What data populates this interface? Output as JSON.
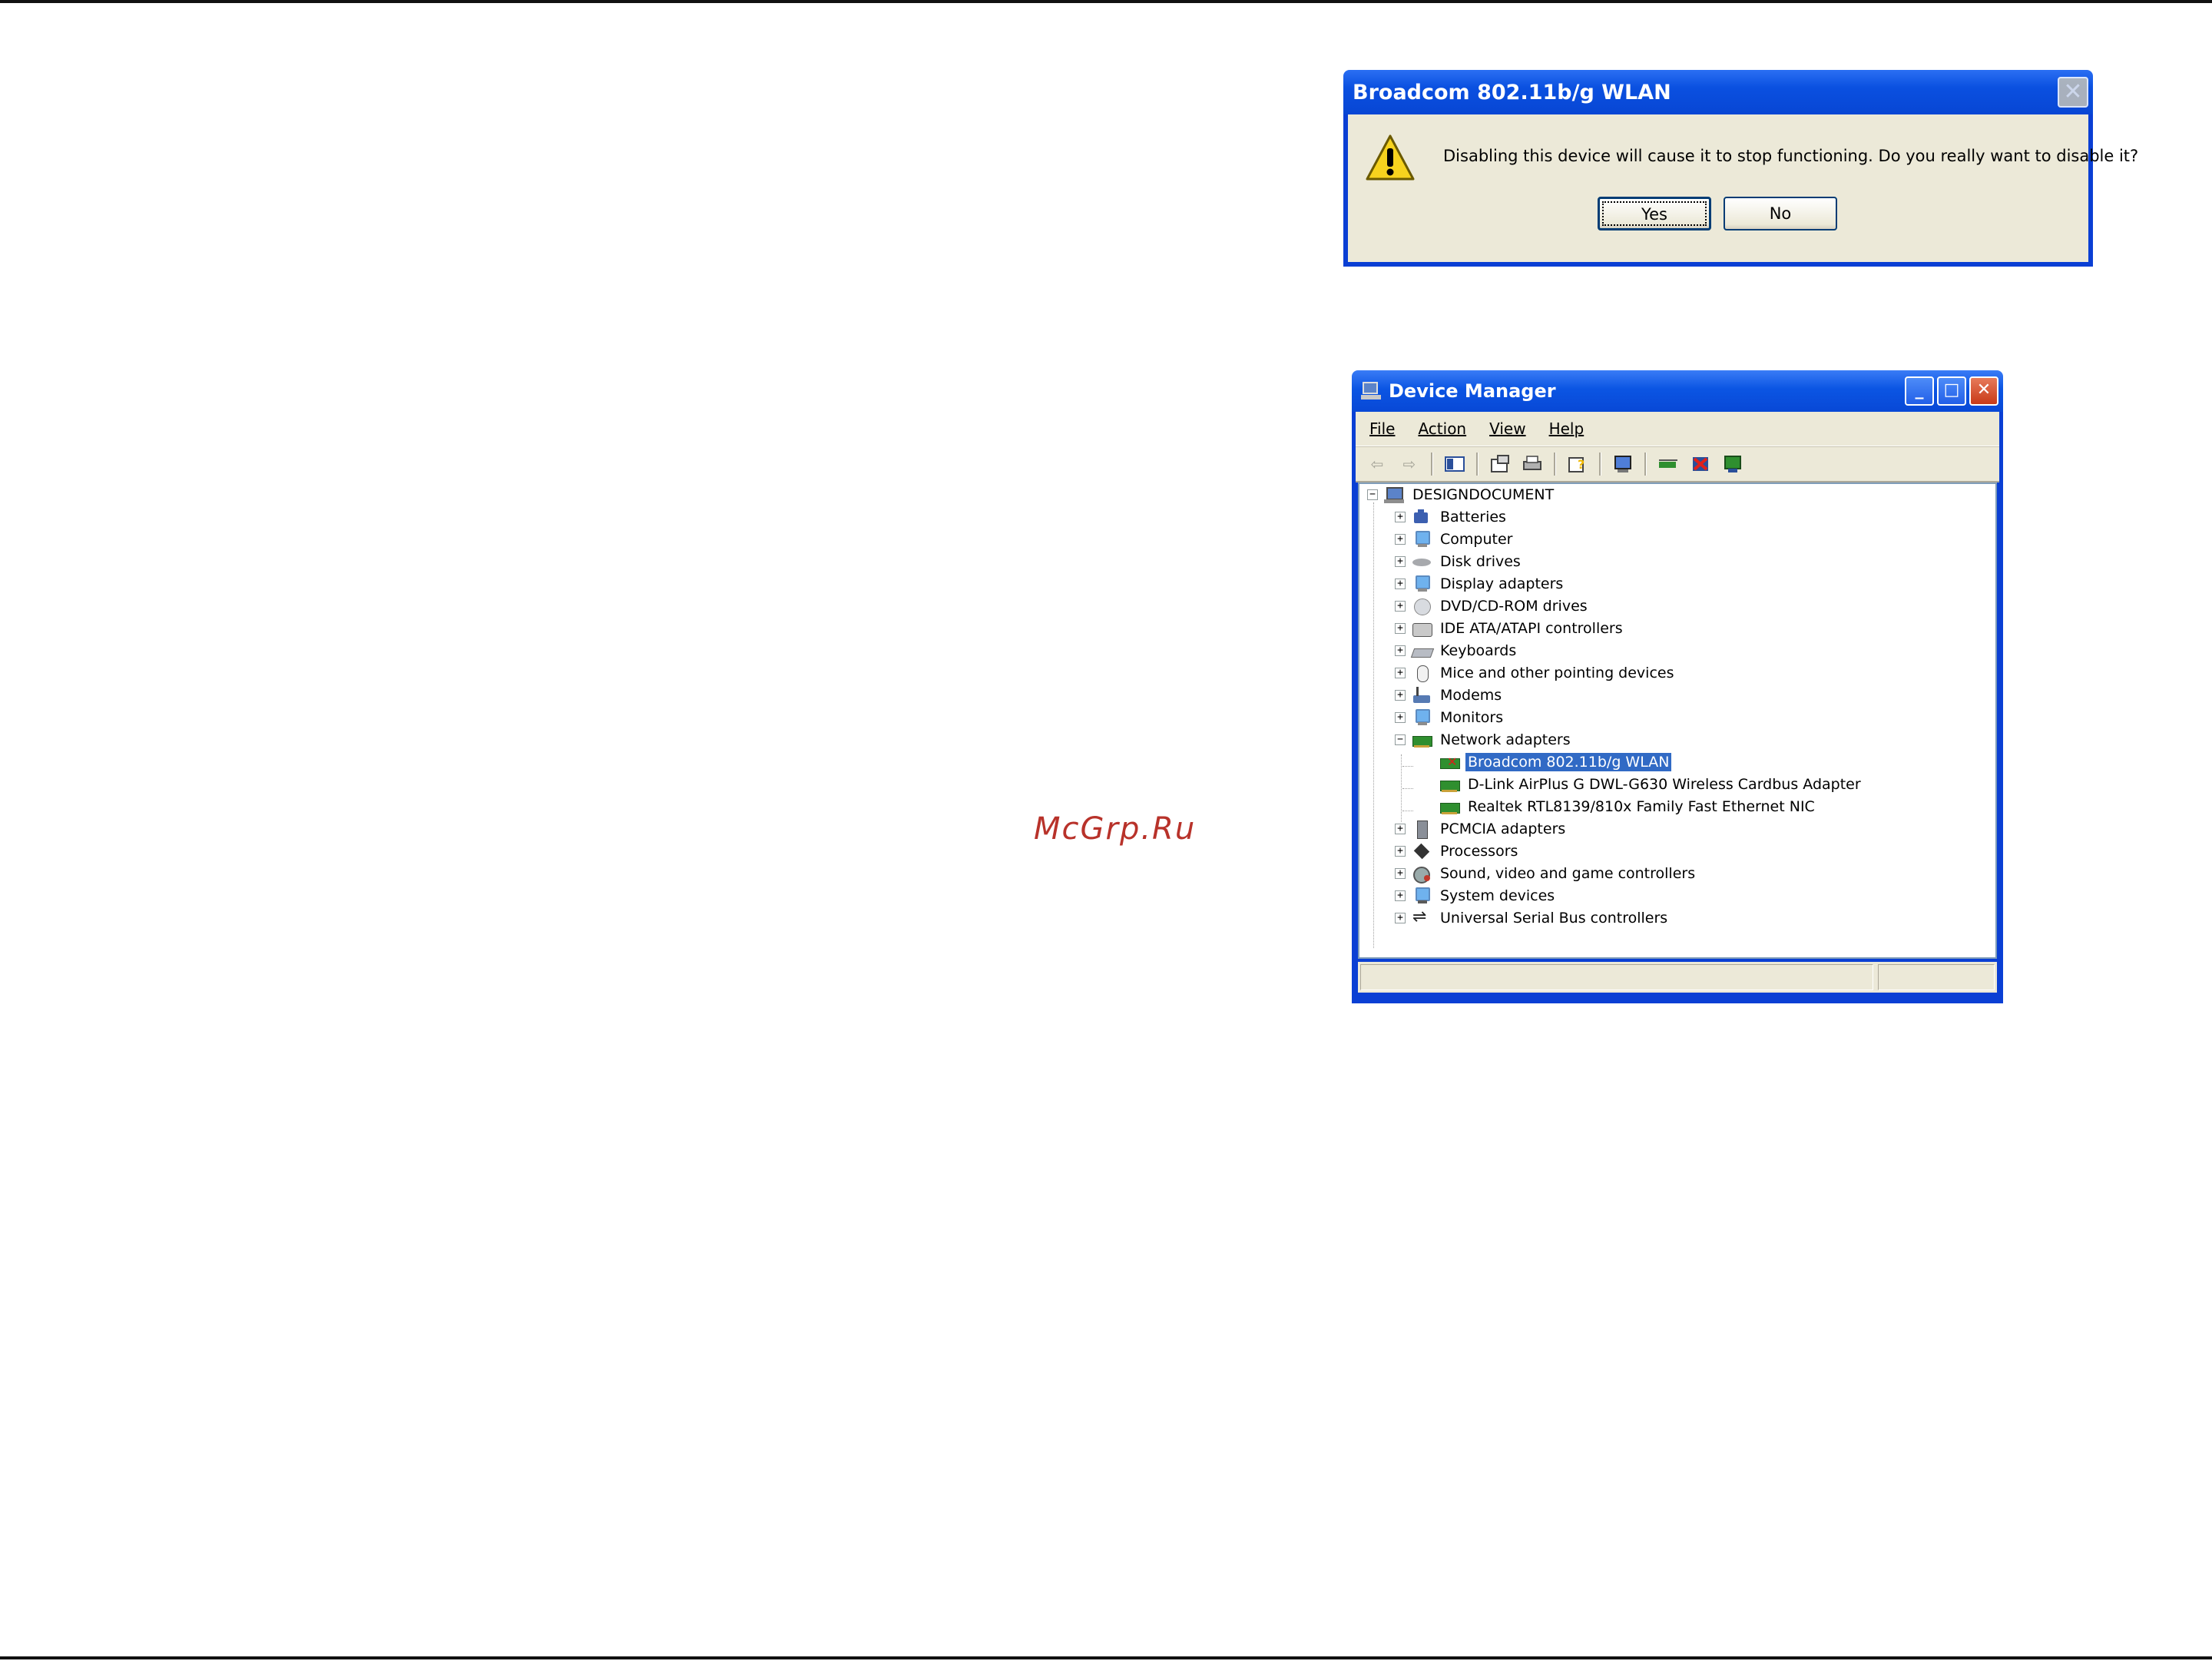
{
  "watermark": "McGrp.Ru",
  "confirm_dialog": {
    "title": "Broadcom 802.11b/g WLAN",
    "close_glyph": "✕",
    "message": "Disabling this device will cause it to stop functioning. Do you really want to disable it?",
    "yes_label": "Yes",
    "no_label": "No",
    "icon": "warning-icon"
  },
  "device_manager": {
    "title": "Device Manager",
    "window_buttons": {
      "minimize": "_",
      "maximize": "□",
      "close": "✕"
    },
    "menu": [
      "File",
      "Action",
      "View",
      "Help"
    ],
    "toolbar_icons": [
      "back-arrow-icon",
      "forward-arrow-icon",
      "show-hide-console-tree-icon",
      "properties-icon",
      "print-icon",
      "help-icon",
      "scan-hardware-icon",
      "update-driver-icon",
      "uninstall-icon",
      "disable-device-icon"
    ],
    "tree": {
      "root": "DESIGNDOCUMENT",
      "categories": [
        {
          "label": "Batteries",
          "icon": "battery-icon",
          "expanded": false
        },
        {
          "label": "Computer",
          "icon": "computer-icon",
          "expanded": false
        },
        {
          "label": "Disk drives",
          "icon": "disk-drive-icon",
          "expanded": false
        },
        {
          "label": "Display adapters",
          "icon": "display-adapter-icon",
          "expanded": false
        },
        {
          "label": "DVD/CD-ROM drives",
          "icon": "cd-rom-icon",
          "expanded": false
        },
        {
          "label": "IDE ATA/ATAPI controllers",
          "icon": "ide-controller-icon",
          "expanded": false
        },
        {
          "label": "Keyboards",
          "icon": "keyboard-icon",
          "expanded": false
        },
        {
          "label": "Mice and other pointing devices",
          "icon": "mouse-icon",
          "expanded": false
        },
        {
          "label": "Modems",
          "icon": "modem-icon",
          "expanded": false
        },
        {
          "label": "Monitors",
          "icon": "monitor-icon",
          "expanded": false
        },
        {
          "label": "Network adapters",
          "icon": "network-adapter-icon",
          "expanded": true,
          "children": [
            {
              "label": "Broadcom 802.11b/g WLAN",
              "selected": true,
              "disabled_mark": true
            },
            {
              "label": "D-Link AirPlus G DWL-G630 Wireless Cardbus Adapter"
            },
            {
              "label": "Realtek RTL8139/810x Family Fast Ethernet NIC"
            }
          ]
        },
        {
          "label": "PCMCIA adapters",
          "icon": "pcmcia-icon",
          "expanded": false
        },
        {
          "label": "Processors",
          "icon": "processor-icon",
          "expanded": false
        },
        {
          "label": "Sound, video and game controllers",
          "icon": "sound-icon",
          "expanded": false
        },
        {
          "label": "System devices",
          "icon": "system-devices-icon",
          "expanded": false
        },
        {
          "label": "Universal Serial Bus controllers",
          "icon": "usb-icon",
          "expanded": false
        }
      ]
    }
  },
  "colors": {
    "xp_title_blue": "#0a50e0",
    "xp_face": "#ece9d8",
    "selection": "#316ac5"
  }
}
